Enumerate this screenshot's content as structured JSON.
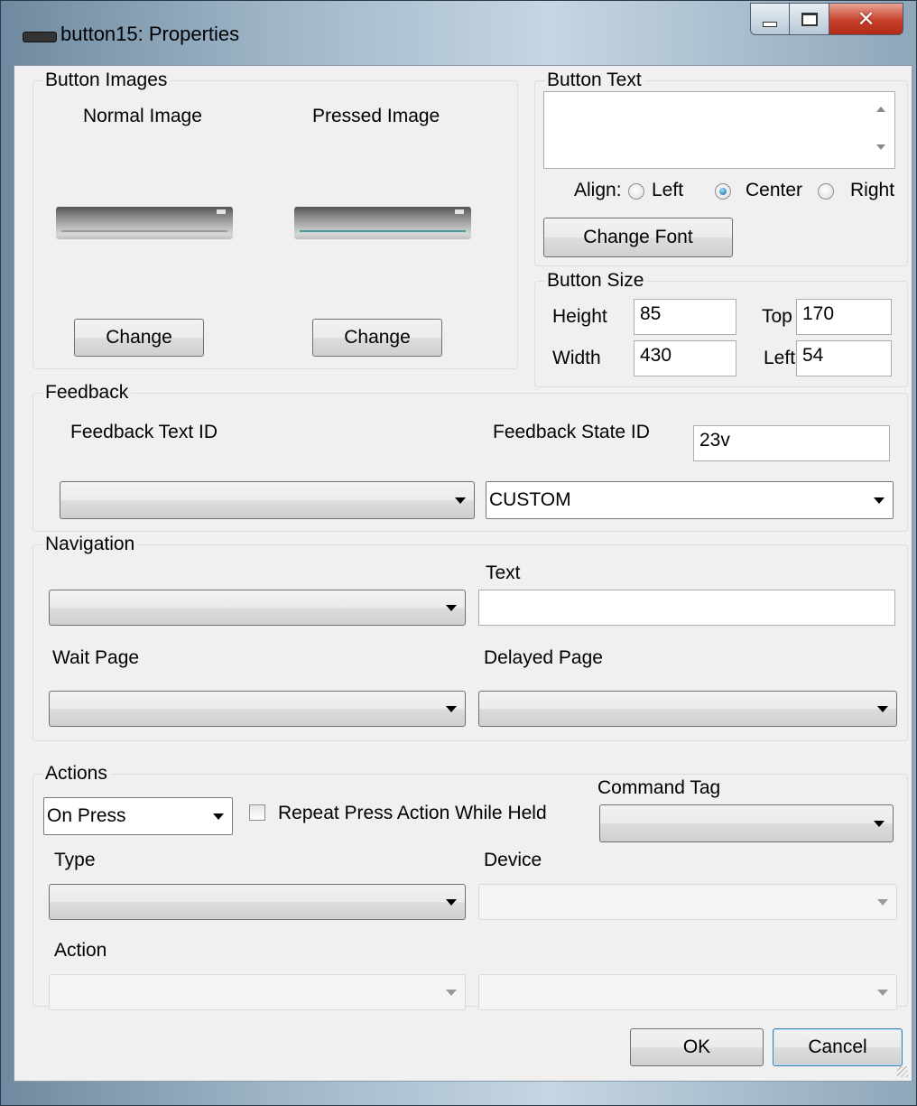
{
  "window": {
    "title": "button15: Properties"
  },
  "button_images": {
    "legend": "Button Images",
    "normal_label": "Normal Image",
    "pressed_label": "Pressed Image",
    "normal_change": "Change",
    "pressed_change": "Change"
  },
  "button_text": {
    "legend": "Button Text",
    "value": "",
    "align_label": "Align:",
    "align_options": [
      "Left",
      "Center",
      "Right"
    ],
    "align_selected": "Center",
    "change_font": "Change Font"
  },
  "button_size": {
    "legend": "Button Size",
    "height_label": "Height",
    "height": "85",
    "width_label": "Width",
    "width": "430",
    "top_label": "Top",
    "top": "170",
    "left_label": "Left",
    "left": "54"
  },
  "feedback": {
    "legend": "Feedback",
    "text_id_label": "Feedback Text ID",
    "text_id_value": "",
    "state_id_label": "Feedback State ID",
    "state_id_value": "23v",
    "state_combo_value": "CUSTOM"
  },
  "navigation": {
    "legend": "Navigation",
    "page_value": "",
    "text_label": "Text",
    "text_value": "",
    "wait_page_label": "Wait Page",
    "wait_page_value": "",
    "delayed_page_label": "Delayed Page",
    "delayed_page_value": ""
  },
  "actions": {
    "legend": "Actions",
    "trigger_value": "On Press",
    "repeat_label": "Repeat Press Action While Held",
    "repeat_checked": false,
    "command_tag_label": "Command Tag",
    "command_tag_value": "",
    "type_label": "Type",
    "type_value": "",
    "device_label": "Device",
    "device_value": "",
    "action_label": "Action",
    "action_value": "",
    "action_param_value": ""
  },
  "footer": {
    "ok": "OK",
    "cancel": "Cancel"
  },
  "colors": {
    "normal_line": "#9a9a9a",
    "pressed_line": "#4a9aa8"
  }
}
